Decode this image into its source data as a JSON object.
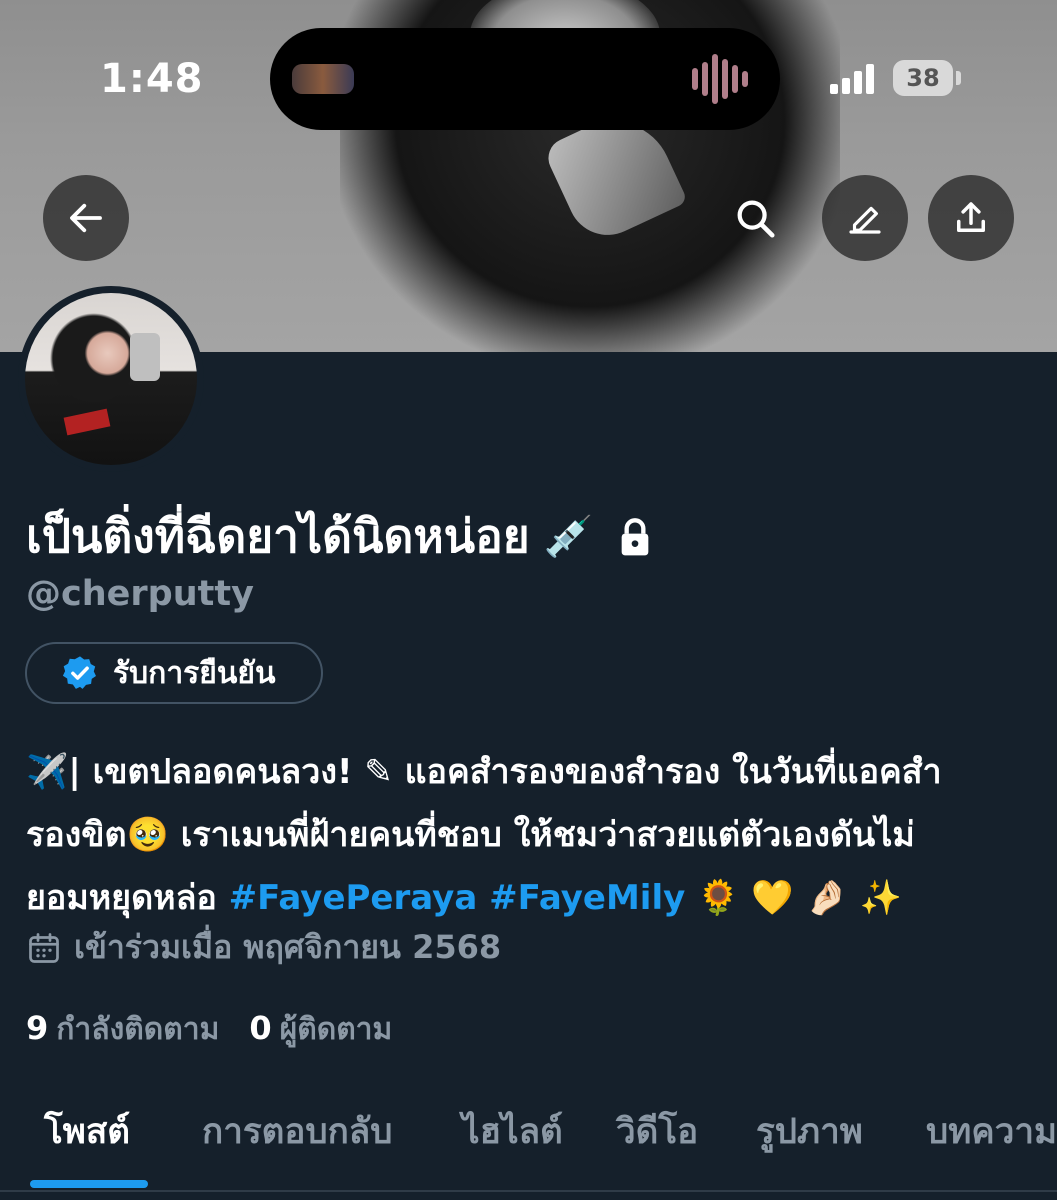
{
  "status_bar": {
    "time": "1:48",
    "battery": "38"
  },
  "profile": {
    "display_name": "เป็นติ่งที่ฉีดยาได้นิดหน่อย",
    "name_emoji": "💉",
    "handle": "@cherputty",
    "verify_label": "รับการยืนยัน",
    "bio_lines": [
      "✈️| เขตปลอดคนลวง! ✎ แอคสำรองของสำรอง ในวันที่แอคสำ",
      "รองขิต🥹 เราเมนพี่ฝ้ายคนที่ชอบ ให้ชมว่าสวยแต่ตัวเองดันไม่"
    ],
    "bio_line3_prefix": "ยอมหยุดหล่อ ",
    "hashtags": [
      "#FayePeraya",
      "#FayeMily"
    ],
    "bio_line3_suffix": " 🌻 💛 🤌🏻 ✨",
    "joined": "เข้าร่วมเมื่อ พฤศจิกายน 2568",
    "following_count": "9",
    "following_label": "กำลังติดตาม",
    "followers_count": "0",
    "followers_label": "ผู้ติดตาม"
  },
  "tabs": [
    {
      "label": "โพสต์",
      "active": true
    },
    {
      "label": "การตอบกลับ",
      "active": false
    },
    {
      "label": "ไฮไลต์",
      "active": false
    },
    {
      "label": "วิดีโอ",
      "active": false
    },
    {
      "label": "รูปภาพ",
      "active": false
    },
    {
      "label": "บทความ",
      "active": false
    }
  ],
  "colors": {
    "background": "#15202b",
    "accent": "#1d9bf0",
    "muted_text": "#8b98a5"
  },
  "icons": [
    "back-arrow-icon",
    "search-icon",
    "edit-icon",
    "share-icon",
    "lock-icon",
    "verified-badge-icon",
    "calendar-icon"
  ]
}
